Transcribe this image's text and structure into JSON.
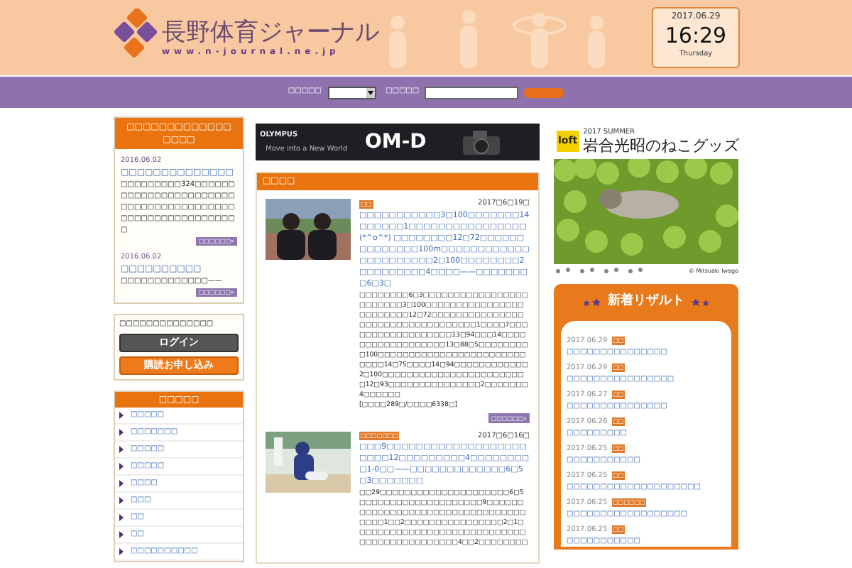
{
  "header": {
    "logo_text": "長野体育ジャーナル",
    "logo_url": "www.n-journal.ne.jp",
    "clock": {
      "date": "2017.06.29",
      "time": "16:29",
      "weekday": "Thursday"
    }
  },
  "search_bar": {
    "category_label": "□□□□□",
    "keyword_label": "□□□□□"
  },
  "notices": {
    "title": "□□□□□□□□□□□□□ □□□□",
    "items": [
      {
        "date": "2016.06.02",
        "title": "□□□□□□□□□□□□□□",
        "body": "□□□□□□□□□324□□□□□□□□□□□□□□□□□□□□□□□□□□□□□□□□□□□□□□□□□□□□□□□□□□□□□□□□□□",
        "button": "□□□□□□»"
      },
      {
        "date": "2016.06.02",
        "title": "□□□□□□□□□□",
        "body": "□□□□□□□□□□□□□——",
        "button": "□□□□□□»"
      }
    ]
  },
  "login": {
    "label": "□□□□□□□□□□□□□□",
    "buttons": [
      "ログイン",
      "購読お申し込み"
    ]
  },
  "menu": {
    "title": "□□□□□",
    "items": [
      "□□□□□",
      "□□□□□□□",
      "□□□□□",
      "□□□□□",
      "□□□□",
      "□□□",
      "□□",
      "□□",
      "□□□□□□□□□□"
    ]
  },
  "ad_banner": {
    "brand": "OLYMPUS",
    "tagline": "Move into a New World",
    "product": "OM-D"
  },
  "news": {
    "title": "□□□□",
    "articles": [
      {
        "kind": "girls",
        "tag": "□□",
        "date": "2017□6□19□",
        "title": "□□□□□□□□□□□3□100□□□□□□□14□□□□□□1□□□□□□□□□□□□□□□□(*^o^*) □□□□□□□□12□72□□□□□□□□□□□□□□100m□□□□□□□□□□□□□□□□□□□□□□2□100□□□□□□□□2□□□□□□□□□4□□□□——□□□□□□□□6□3□",
        "body": "□□□□□□□□6□3□□□□□□□□□□□□□□□□□□□□□□□□3□100□□□□□□□□□□□□□□□□□□□□□□□□12□72□□□□□□□□□□□□□□□□□□□□□□□□□□□□□□□□□□1□□□□7□□□□□□□□□□□□□□□□□□13□94□□□14□□□□□□□□□□□□□□□□□□13□88□5□□□□□□□□□100□□□□□□□□□□□□□□□□□□□□□□□□□□□□14□75□□□□14□94□□□□□□□□□□□□2□100□□□□□□□□□□□□□□□□□□□□□□□□12□93□□□□□□□□□□□□□□□2□□□□□□□4□□□□□□",
        "stats": "[□□□□289□/□□□□6338□]",
        "button": "□□□□□□»"
      },
      {
        "kind": "baseball",
        "tag": "□□□□□□□",
        "date": "2017□6□16□",
        "title": "□□□9□□□□□□□□□□□□□□□□□□□□□□□12□□□□□□□□□4□□□□□□□□□1-0□□——□□□□□□□□□□□□□6□5□3□□□□□□□",
        "body": "□□29□□□□□□□□□□□□□□□□□□□□□6□5□□□□□□□□□□□□□□□□□□□□9□□□□□□□□□□□□□□□□□□□□□□□□□□□□□□□□□□□□□1□□2□□□□□□□□□□□□□□□□2□1□□□□□□□□□□□□□□□□□□□□□□□□□□□□□□□□□□□□□□□□□□□□4□□2□□□□□□□□"
      }
    ]
  },
  "promo": {
    "badge": "loft",
    "season": "2017 SUMMER",
    "title": "岩合光昭のねこグッズ",
    "credit": "© Mitsuaki Iwago"
  },
  "results": {
    "title": "新着リザルト",
    "items": [
      {
        "date": "2017.06.29",
        "tag": "□□",
        "title": "□□□□□□□□□□□□□□□"
      },
      {
        "date": "2017.06.29",
        "tag": "□□",
        "title": "□□□□□□□□□□□□□□□□"
      },
      {
        "date": "2017.06.27",
        "tag": "□□",
        "title": "□□□□□□□□□□□□□□□"
      },
      {
        "date": "2017.06.26",
        "tag": "□□",
        "title": "□□□□□□□□□"
      },
      {
        "date": "2017.06.25",
        "tag": "□□",
        "title": "□□□□□□□□□□□"
      },
      {
        "date": "2017.06.25",
        "tag": "□□",
        "title": "□□□□□□□□□□□□□□□□□□□□"
      },
      {
        "date": "2017.06.25",
        "tag": "□□□□□□",
        "title": "□□□□□□□□□□□□□□□□□□"
      },
      {
        "date": "2017.06.25",
        "tag": "□□",
        "title": "□□□□□□□□□□□"
      }
    ]
  }
}
